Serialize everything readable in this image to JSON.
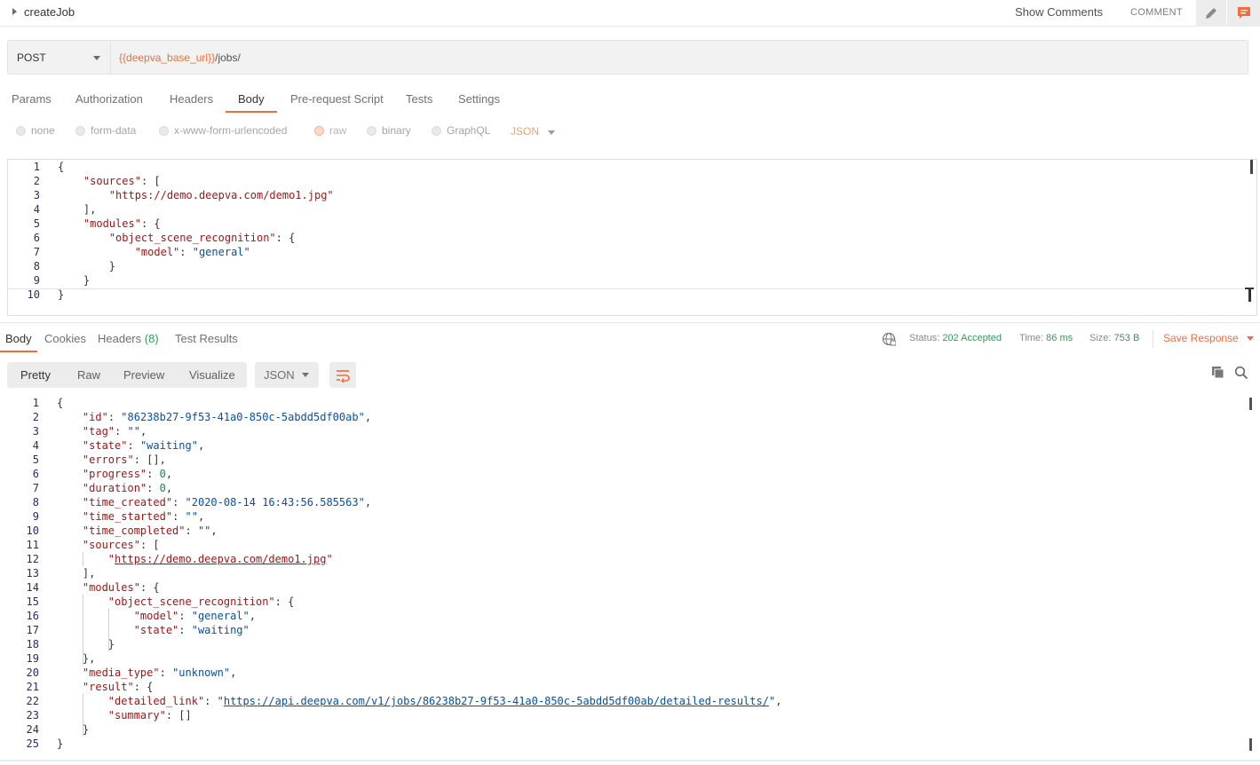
{
  "header": {
    "request_name": "createJob",
    "show_comments": "Show Comments",
    "comment": "COMMENT",
    "icons": [
      "caret-right-icon",
      "pencil-icon",
      "comment-icon"
    ]
  },
  "request": {
    "method": "POST",
    "url_variable": "{{deepva_base_url}}",
    "url_path": "/jobs/"
  },
  "request_tabs": [
    {
      "label": "Params"
    },
    {
      "label": "Authorization"
    },
    {
      "label": "Headers"
    },
    {
      "label": "Body",
      "active": true
    },
    {
      "label": "Pre-request Script"
    },
    {
      "label": "Tests"
    },
    {
      "label": "Settings"
    }
  ],
  "body_types": {
    "options": [
      "none",
      "form-data",
      "x-www-form-urlencoded",
      "raw",
      "binary",
      "GraphQL"
    ],
    "selected": "raw",
    "format": "JSON"
  },
  "request_body_lines": [
    {
      "n": "1",
      "html": "<span class='p'>{</span>"
    },
    {
      "n": "2",
      "html": "    <span class='k'>\"sources\"</span><span class='p'>: [</span>"
    },
    {
      "n": "3",
      "html": "        <span class='k'>\"https://demo.deepva.com/demo1.jpg\"</span>"
    },
    {
      "n": "4",
      "html": "    <span class='p'>],</span>"
    },
    {
      "n": "5",
      "html": "    <span class='k'>\"modules\"</span><span class='p'>: {</span>"
    },
    {
      "n": "6",
      "html": "        <span class='k'>\"object_scene_recognition\"</span><span class='p'>: {</span>"
    },
    {
      "n": "7",
      "html": "            <span class='k'>\"model\"</span><span class='p'>: </span><span class='s'>\"general\"</span>"
    },
    {
      "n": "8",
      "html": "        <span class='p'>}</span>"
    },
    {
      "n": "9",
      "html": "    <span class='p'>}</span>"
    },
    {
      "n": "10",
      "html": "<span class='p'>}</span>"
    }
  ],
  "response_tabs": [
    {
      "label": "Body",
      "active": true
    },
    {
      "label": "Cookies"
    },
    {
      "label": "Headers",
      "count": "(8)"
    },
    {
      "label": "Test Results"
    }
  ],
  "response_meta": {
    "status_label": "Status:",
    "status_value": "202 Accepted",
    "time_label": "Time:",
    "time_value": "86 ms",
    "size_label": "Size:",
    "size_value": "753 B",
    "save_response": "Save Response"
  },
  "view_modes": {
    "options": [
      "Pretty",
      "Raw",
      "Preview",
      "Visualize"
    ],
    "selected": "Pretty",
    "format": "JSON"
  },
  "response_body_lines": [
    {
      "n": "1",
      "html": "<span class='p'>{</span>"
    },
    {
      "n": "2",
      "html": "    <span class='k'>\"id\"</span><span class='p'>: </span><span class='s'>\"86238b27-9f53-41a0-850c-5abdd5df00ab\"</span><span class='p'>,</span>"
    },
    {
      "n": "3",
      "html": "    <span class='k'>\"tag\"</span><span class='p'>: </span><span class='s'>\"\"</span><span class='p'>,</span>"
    },
    {
      "n": "4",
      "html": "    <span class='k'>\"state\"</span><span class='p'>: </span><span class='s'>\"waiting\"</span><span class='p'>,</span>"
    },
    {
      "n": "5",
      "html": "    <span class='k'>\"errors\"</span><span class='p'>: [],</span>"
    },
    {
      "n": "6",
      "html": "    <span class='k'>\"progress\"</span><span class='p'>: </span><span class='n'>0</span><span class='p'>,</span>"
    },
    {
      "n": "7",
      "html": "    <span class='k'>\"duration\"</span><span class='p'>: </span><span class='n'>0</span><span class='p'>,</span>"
    },
    {
      "n": "8",
      "html": "    <span class='k'>\"time_created\"</span><span class='p'>: </span><span class='s'>\"2020-08-14 16:43:56.585563\"</span><span class='p'>,</span>"
    },
    {
      "n": "9",
      "html": "    <span class='k'>\"time_started\"</span><span class='p'>: </span><span class='s'>\"\"</span><span class='p'>,</span>"
    },
    {
      "n": "10",
      "html": "    <span class='k'>\"time_completed\"</span><span class='p'>: </span><span class='s'>\"\"</span><span class='p'>,</span>"
    },
    {
      "n": "11",
      "html": "    <span class='k'>\"sources\"</span><span class='p'>: [</span>"
    },
    {
      "n": "12",
      "html": "        <span class='k'>\"</span><span class='lnk-red'>https://demo.deepva.com/demo1.jpg</span><span class='k'>\"</span>"
    },
    {
      "n": "13",
      "html": "    <span class='p'>],</span>"
    },
    {
      "n": "14",
      "html": "    <span class='k'>\"modules\"</span><span class='p'>: {</span>"
    },
    {
      "n": "15",
      "html": "        <span class='k'>\"object_scene_recognition\"</span><span class='p'>: {</span>"
    },
    {
      "n": "16",
      "html": "            <span class='k'>\"model\"</span><span class='p'>: </span><span class='s'>\"general\"</span><span class='p'>,</span>"
    },
    {
      "n": "17",
      "html": "            <span class='k'>\"state\"</span><span class='p'>: </span><span class='s'>\"waiting\"</span>"
    },
    {
      "n": "18",
      "html": "        <span class='p'>}</span>"
    },
    {
      "n": "19",
      "html": "    <span class='p'>},</span>"
    },
    {
      "n": "20",
      "html": "    <span class='k'>\"media_type\"</span><span class='p'>: </span><span class='s'>\"unknown\"</span><span class='p'>,</span>"
    },
    {
      "n": "21",
      "html": "    <span class='k'>\"result\"</span><span class='p'>: {</span>"
    },
    {
      "n": "22",
      "html": "        <span class='k'>\"detailed_link\"</span><span class='p'>: </span><span class='s'>\"</span><span class='lnk'>https://api.deepva.com/v1/jobs/86238b27-9f53-41a0-850c-5abdd5df00ab/detailed-results/</span><span class='s'>\"</span><span class='p'>,</span>"
    },
    {
      "n": "23",
      "html": "        <span class='k'>\"summary\"</span><span class='p'>: []</span>"
    },
    {
      "n": "24",
      "html": "    <span class='p'>}</span>"
    },
    {
      "n": "25",
      "html": "<span class='p'>}</span>"
    }
  ],
  "colors": {
    "accent": "#f26b3a",
    "success": "#2e9d5a",
    "json_key": "#a31515",
    "json_string": "#0451a5",
    "json_number": "#098658"
  }
}
